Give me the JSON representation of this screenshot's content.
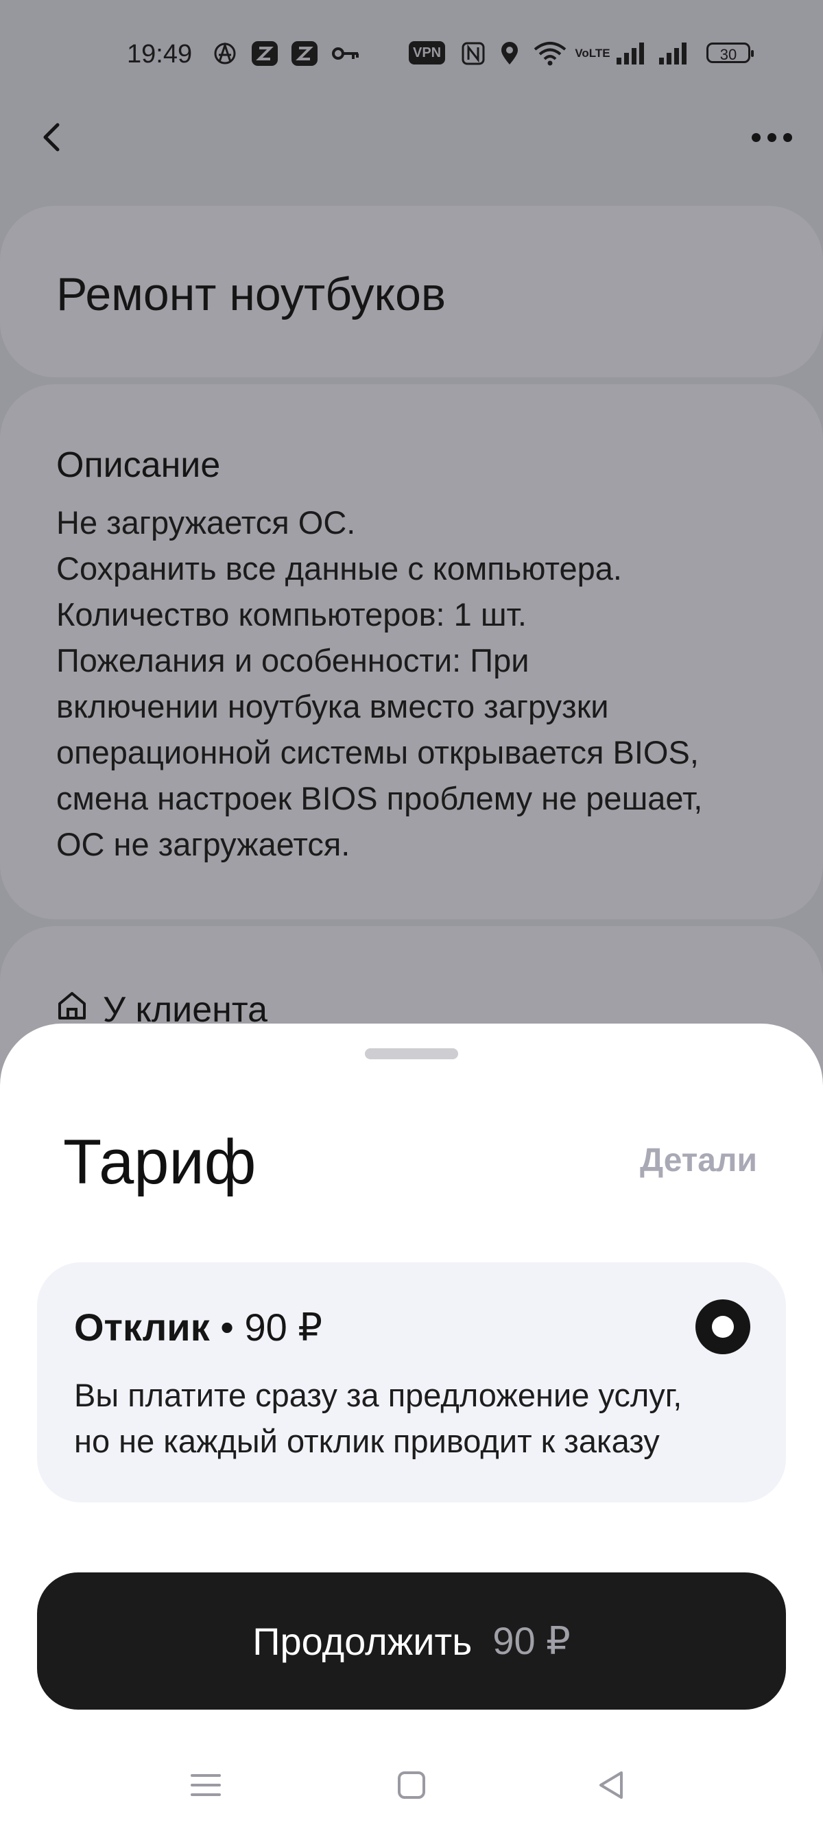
{
  "status_bar": {
    "time": "19:49",
    "vpn_label": "VPN",
    "volte_label": "VoLTE",
    "battery": "30",
    "icons": [
      "anarchy-icon",
      "app-z-icon",
      "app-z-icon",
      "key-icon",
      "vpn-icon",
      "nfc-icon",
      "location-icon",
      "wifi-icon",
      "volte-icon",
      "signal-icon",
      "signal-icon",
      "battery-icon"
    ]
  },
  "header": {
    "back_icon": "back-arrow-icon",
    "more_icon": "more-dots-icon"
  },
  "service": {
    "title": "Ремонт ноутбуков"
  },
  "description": {
    "heading": "Описание",
    "lines": [
      "Не загружается ОС.",
      "Сохранить все данные с компьютера.",
      "Количество компьютеров: 1 шт.",
      "Пожелания и особенности: При",
      "включении ноутбука вместо загрузки",
      "операционной системы открывается BIOS,",
      "смена настроек BIOS проблему не решает,",
      "ОС не загружается."
    ]
  },
  "location": {
    "icon": "home-icon",
    "label": "У клиента"
  },
  "sheet": {
    "title": "Тариф",
    "details_link": "Детали",
    "tariff": {
      "name": "Отклик",
      "separator": "•",
      "price": "90 ₽",
      "selected": true,
      "description_lines": [
        "Вы платите сразу за предложение услуг,",
        "но не каждый отклик приводит к заказу"
      ]
    },
    "continue_button": {
      "label": "Продолжить",
      "price": "90 ₽"
    }
  },
  "nav_bar": {
    "items": [
      "menu-icon",
      "home-square-icon",
      "back-triangle-icon"
    ]
  }
}
